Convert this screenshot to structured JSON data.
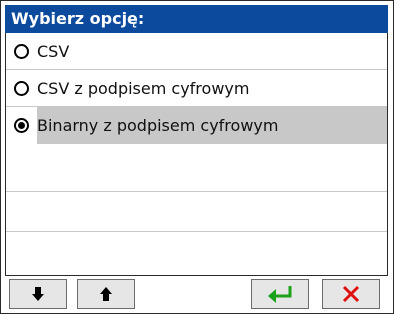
{
  "dialog": {
    "title": "Wybierz opcję:"
  },
  "options": [
    {
      "label": "CSV",
      "checked": false
    },
    {
      "label": "CSV z podpisem cyfrowym",
      "checked": false
    },
    {
      "label": "Binarny z podpisem cyfrowym",
      "checked": true
    }
  ],
  "toolbar": {
    "buttons": [
      {
        "icon": "arrow-down-icon",
        "color": "#000000"
      },
      {
        "icon": "arrow-up-icon",
        "color": "#000000"
      },
      {
        "icon": "enter-icon",
        "color": "#1aa31a"
      },
      {
        "icon": "close-icon",
        "color": "#e01010"
      }
    ]
  },
  "colors": {
    "title_bg": "#0c4a9e",
    "title_text": "#ffffff",
    "selected_row_bg": "#c8c8c8"
  }
}
